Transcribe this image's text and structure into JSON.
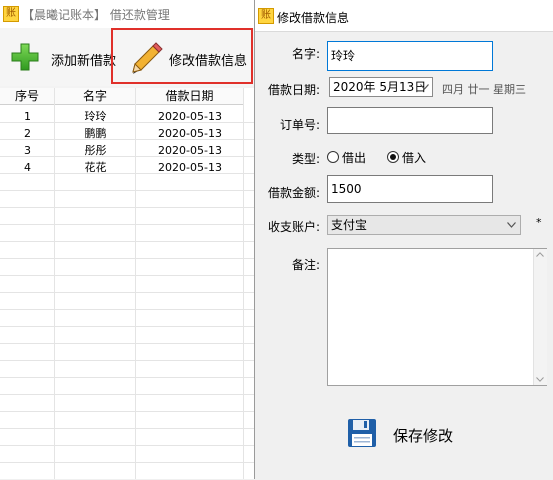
{
  "back_window": {
    "title": "【晨曦记账本】 借还款管理",
    "toolbar": {
      "add_label": "添加新借款",
      "edit_label": "修改借款信息"
    },
    "table": {
      "columns": [
        "序号",
        "名字",
        "借款日期"
      ],
      "rows": [
        [
          "1",
          "玲玲",
          "2020-05-13"
        ],
        [
          "2",
          "鹏鹏",
          "2020-05-13"
        ],
        [
          "3",
          "彤彤",
          "2020-05-13"
        ],
        [
          "4",
          "花花",
          "2020-05-13"
        ]
      ]
    }
  },
  "dialog": {
    "title": "修改借款信息",
    "name_label": "名字:",
    "name_value": "玲玲",
    "date_label": "借款日期:",
    "date_value": "2020年  5月13日",
    "date_side_text": "四月 廿一 星期三",
    "order_label": "订单号:",
    "order_value": "",
    "type_label": "类型:",
    "type_options": [
      "借出",
      "借入"
    ],
    "type_selected": "借入",
    "amount_label": "借款金额:",
    "amount_value": "1500",
    "account_label": "收支账户:",
    "account_value": "支付宝",
    "account_marker": "*",
    "note_label": "备注:",
    "note_value": "",
    "save_label": "保存修改"
  },
  "colors": {
    "highlight_border": "#e0302a",
    "focus_border": "#0078d7",
    "save_icon": "#1f5fa8"
  }
}
